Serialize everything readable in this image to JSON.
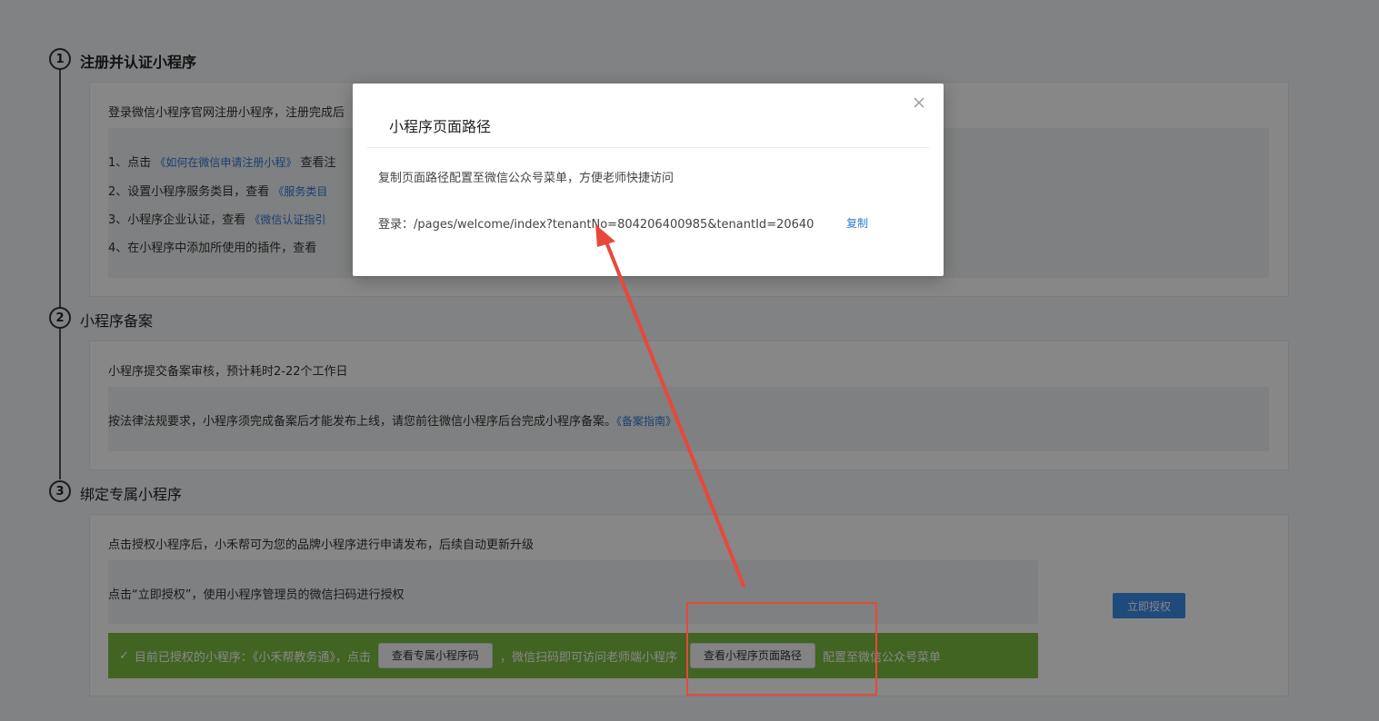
{
  "steps": [
    {
      "number": "1",
      "title": "注册并认证小程序",
      "intro": "登录微信小程序官网注册小程序，注册完成后",
      "items": [
        {
          "prefix": "1、点击 ",
          "link": "《如何在微信申请注册小程》",
          "suffix": " 查看注"
        },
        {
          "prefix": "2、设置小程序服务类目，查看 ",
          "link": "《服务类目",
          "suffix": ""
        },
        {
          "prefix": "3、小程序企业认证，查看 ",
          "link": "《微信认证指引",
          "suffix": ""
        },
        {
          "prefix": "4、在小程序中添加所使用的插件，查看",
          "link": "",
          "suffix": ""
        }
      ]
    },
    {
      "number": "2",
      "title": "小程序备案",
      "intro": "小程序提交备案审核，预计耗时2-22个工作日",
      "notice": "按法律法规要求，小程序须完成备案后才能发布上线，请您前往微信小程序后台完成小程序备案。",
      "notice_link": "《备案指南》"
    },
    {
      "number": "3",
      "title": "绑定专属小程序",
      "intro": "点击授权小程序后，小禾帮可为您的品牌小程序进行申请发布，后续自动更新升级",
      "notice": "点击“立即授权”，使用小程序管理员的微信扫码进行授权",
      "auth_button": "立即授权",
      "green_bar": {
        "check": "✓",
        "part1": "目前已授权的小程序：《小禾帮教务通》，点击",
        "button1": "查看专属小程序码",
        "part2": "，微信扫码即可访问老师端小程序",
        "button2": "查看小程序页面路径",
        "part3": "配置至微信公众号菜单"
      }
    }
  ],
  "modal": {
    "title": "小程序页面路径",
    "description": "复制页面路径配置至微信公众号菜单，方便老师快捷访问",
    "path_label": "登录：",
    "path_value": "/pages/welcome/index?tenantNo=804206400985&tenantId=20640",
    "copy_label": "复制",
    "close_icon": "close-icon"
  },
  "colors": {
    "accent": "#3b8cea",
    "link": "#2d7bd6",
    "green_bar": "#7cbe43",
    "annotation": "#e8483a"
  }
}
